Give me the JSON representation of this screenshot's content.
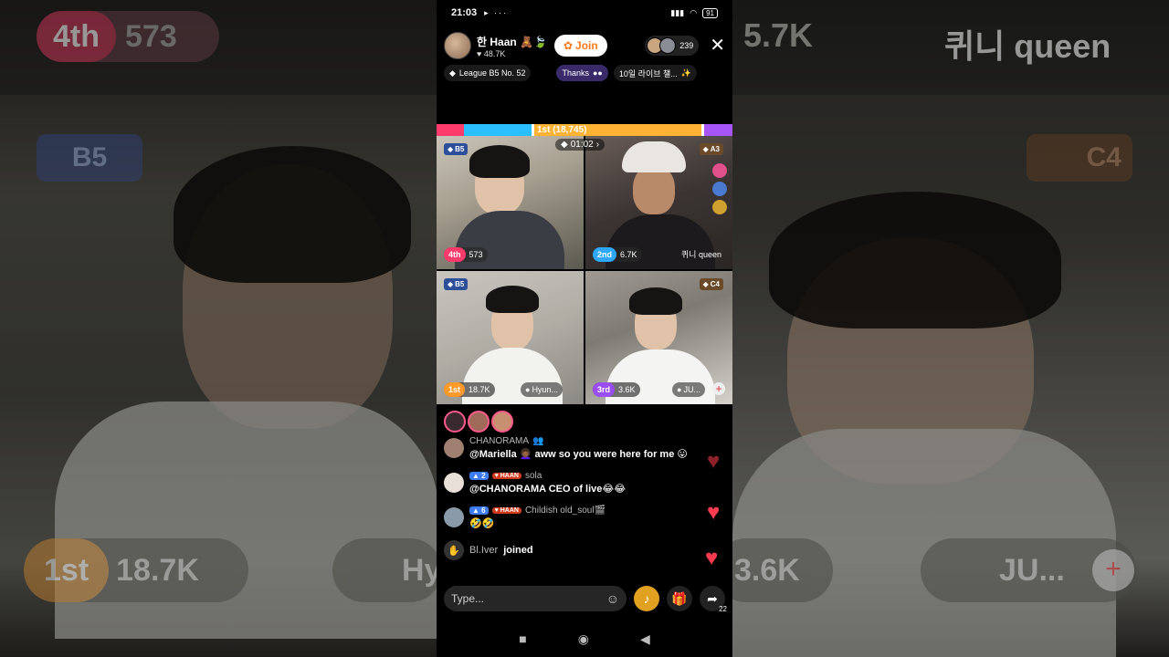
{
  "status": {
    "time": "21:03",
    "indicators": "▸ ···",
    "battery": "91"
  },
  "host": {
    "name": "한 Haan",
    "emoji": "🧸🍃",
    "likes": "48.7K",
    "join_label": "Join",
    "viewer_count": "239"
  },
  "tags": {
    "league": "League B5 No. 52",
    "thanks": "Thanks",
    "event": "10일 라이브 챌..."
  },
  "battle": {
    "leader_label": "1st (18,745)",
    "timer": "01:02"
  },
  "tiles": [
    {
      "tier": "B5",
      "rank": "4th",
      "score": "573",
      "name": ""
    },
    {
      "tier": "A3",
      "rank": "2nd",
      "score": "6.7K",
      "name": "퀴니 queen"
    },
    {
      "tier": "B5",
      "rank": "1st",
      "score": "18.7K",
      "name": "Hyun..."
    },
    {
      "tier": "C4",
      "rank": "3rd",
      "score": "3.6K",
      "name": "JU..."
    }
  ],
  "chat": [
    {
      "user": "CHANORAMA",
      "user_suffix": "👥",
      "level": "",
      "fan": "",
      "text": "@Mariella 👩🏾‍🦱 aww so you were here for me 😛"
    },
    {
      "user": "sola",
      "user_suffix": "",
      "level": "2",
      "fan": "HAAN",
      "text": "@CHANORAMA CEO of live😂😂"
    },
    {
      "user": "Childish old_soul🎬",
      "user_suffix": "",
      "level": "6",
      "fan": "HAAN",
      "text": "🤣🤣"
    }
  ],
  "joined": {
    "user": "Bl.Iver",
    "action": "joined"
  },
  "input": {
    "placeholder": "Type...",
    "share_count": "22"
  },
  "background": {
    "left_rank": "4th",
    "left_score": "573",
    "left_tier": "B5",
    "left_bottom_rank": "1st",
    "left_bottom_score": "18.7K",
    "left_bottom_name": "Hy",
    "right_score_top": "5.7K",
    "right_name": "퀴니 queen",
    "right_tier": "C4",
    "right_bottom_score": "3.6K",
    "right_bottom_name": "JU..."
  },
  "colors": {
    "accent": "#ff7a1a",
    "heart": "#ff3b4f",
    "rank_pink": "#ff3b6b"
  }
}
